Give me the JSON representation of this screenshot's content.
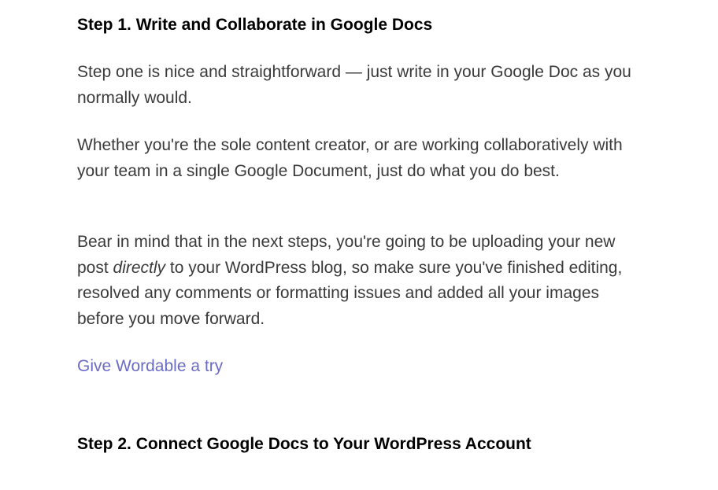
{
  "step1": {
    "heading": "Step 1. Write and Collaborate in Google Docs",
    "para1": "Step one is nice and straightforward — just write in your Google Doc as you normally would.",
    "para2": "Whether you're the sole content creator, or are working collaboratively with your team in a single Google Document, just do what you do best.",
    "para3_pre": "Bear in mind that in the next steps, you're going to be uploading your new post ",
    "para3_emphasis": "directly",
    "para3_post": " to your WordPress blog, so make sure you've finished editing, resolved any comments or formatting issues and added all your images before you move forward.",
    "link_text": "Give Wordable a try"
  },
  "step2": {
    "heading": "Step 2. Connect Google Docs to Your WordPress Account"
  }
}
